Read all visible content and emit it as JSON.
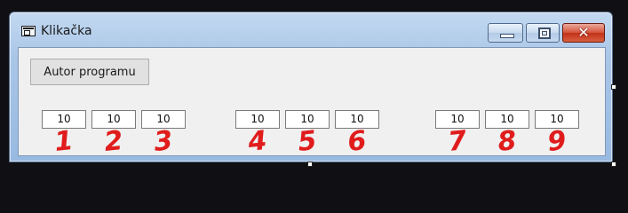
{
  "window": {
    "title": "Klikačka",
    "icon": "app-window-icon",
    "controls": {
      "minimize": "minimize-icon",
      "maximize": "maximize-icon",
      "close": "close-icon"
    }
  },
  "author_button": {
    "label": "Autor programu"
  },
  "number_boxes": [
    {
      "value": "10",
      "label": "1"
    },
    {
      "value": "10",
      "label": "2"
    },
    {
      "value": "10",
      "label": "3"
    },
    {
      "value": "10",
      "label": "4"
    },
    {
      "value": "10",
      "label": "5"
    },
    {
      "value": "10",
      "label": "6"
    },
    {
      "value": "10",
      "label": "7"
    },
    {
      "value": "10",
      "label": "8"
    },
    {
      "value": "10",
      "label": "9"
    }
  ],
  "colors": {
    "annotation": "#e01c1c",
    "close_button": "#c2311a"
  }
}
